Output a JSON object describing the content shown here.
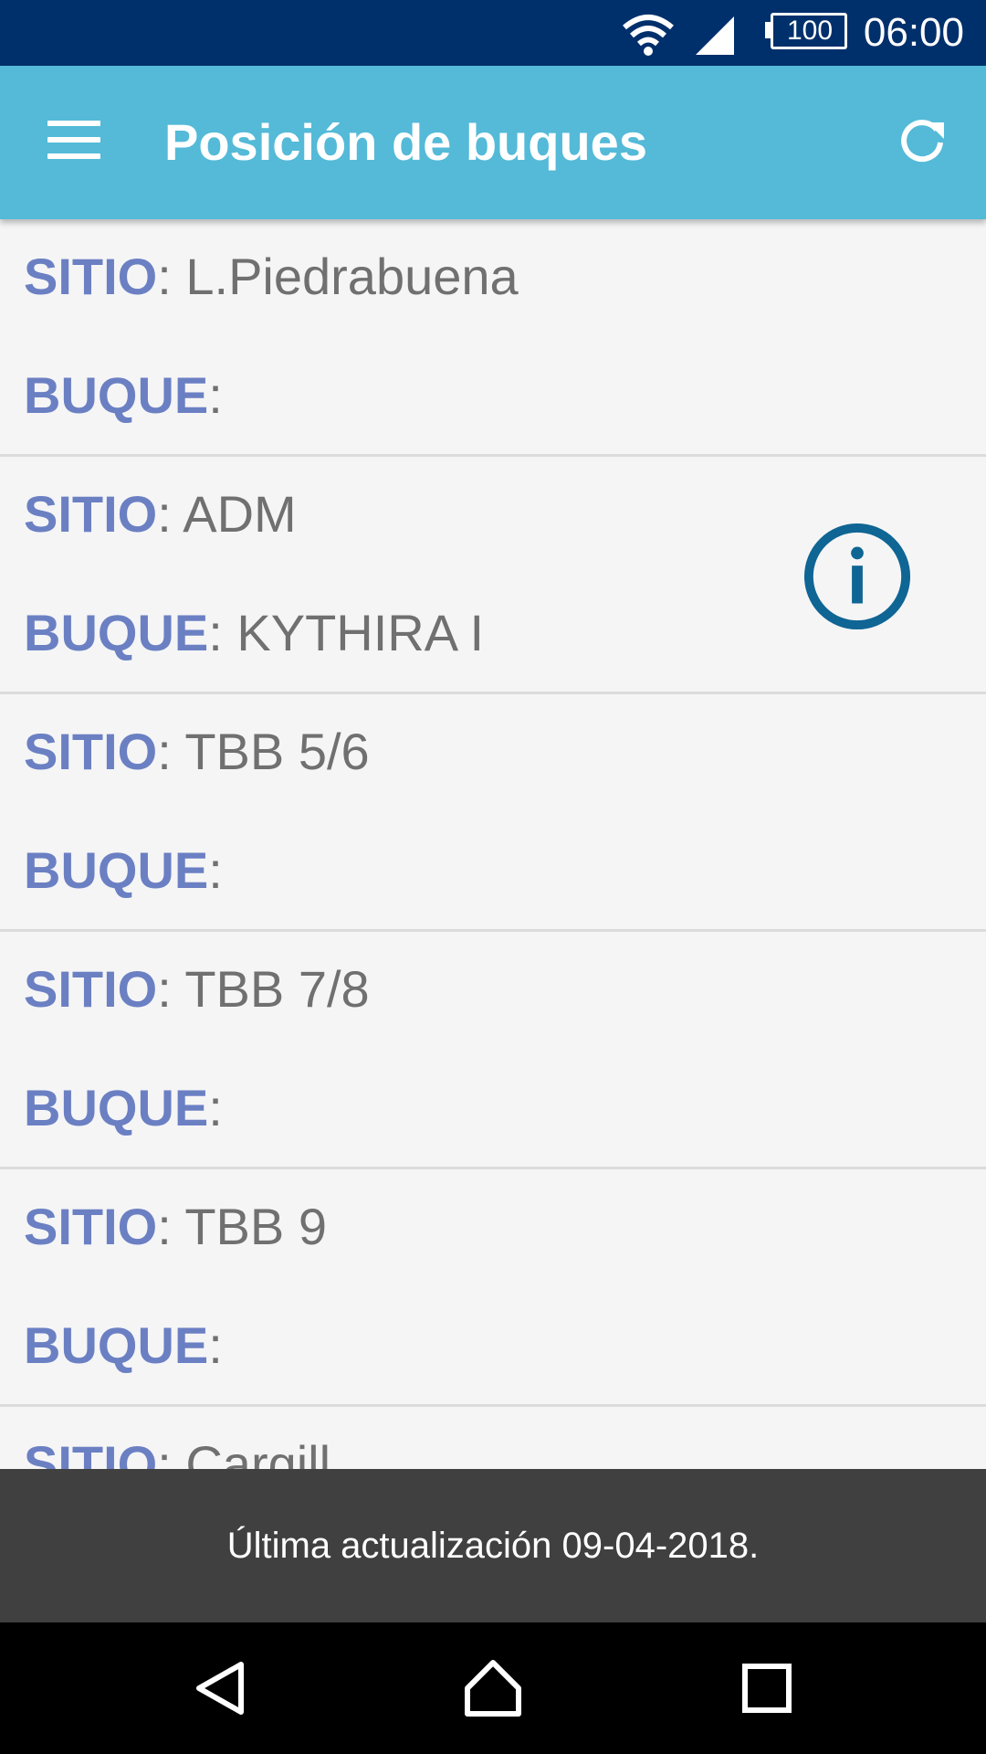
{
  "status_bar": {
    "time": "06:00",
    "battery": "100",
    "icons": [
      "wifi-icon",
      "signal-icon",
      "battery-icon"
    ]
  },
  "app_bar": {
    "title": "Posición de buques",
    "menu_icon": "menu-icon",
    "refresh_icon": "refresh-icon",
    "color": "#54bad8"
  },
  "colors": {
    "label": "#6b80c3",
    "value": "#707070",
    "info_icon": "#0f6593"
  },
  "list": {
    "label_sitio": "SITIO",
    "label_buque": "BUQUE",
    "separator": ":",
    "items": [
      {
        "sitio": "L.Piedrabuena",
        "buque": ""
      },
      {
        "sitio": "ADM",
        "buque": "KYTHIRA I",
        "info_icon": "info-icon"
      },
      {
        "sitio": "TBB 5/6",
        "buque": ""
      },
      {
        "sitio": "TBB 7/8",
        "buque": ""
      },
      {
        "sitio": "TBB 9",
        "buque": ""
      },
      {
        "sitio": "Cargill",
        "buque": ""
      }
    ]
  },
  "snackbar": {
    "text": "Última actualización 09-04-2018."
  },
  "nav_bar": {
    "icons": [
      "back-icon",
      "home-icon",
      "recents-icon"
    ]
  }
}
